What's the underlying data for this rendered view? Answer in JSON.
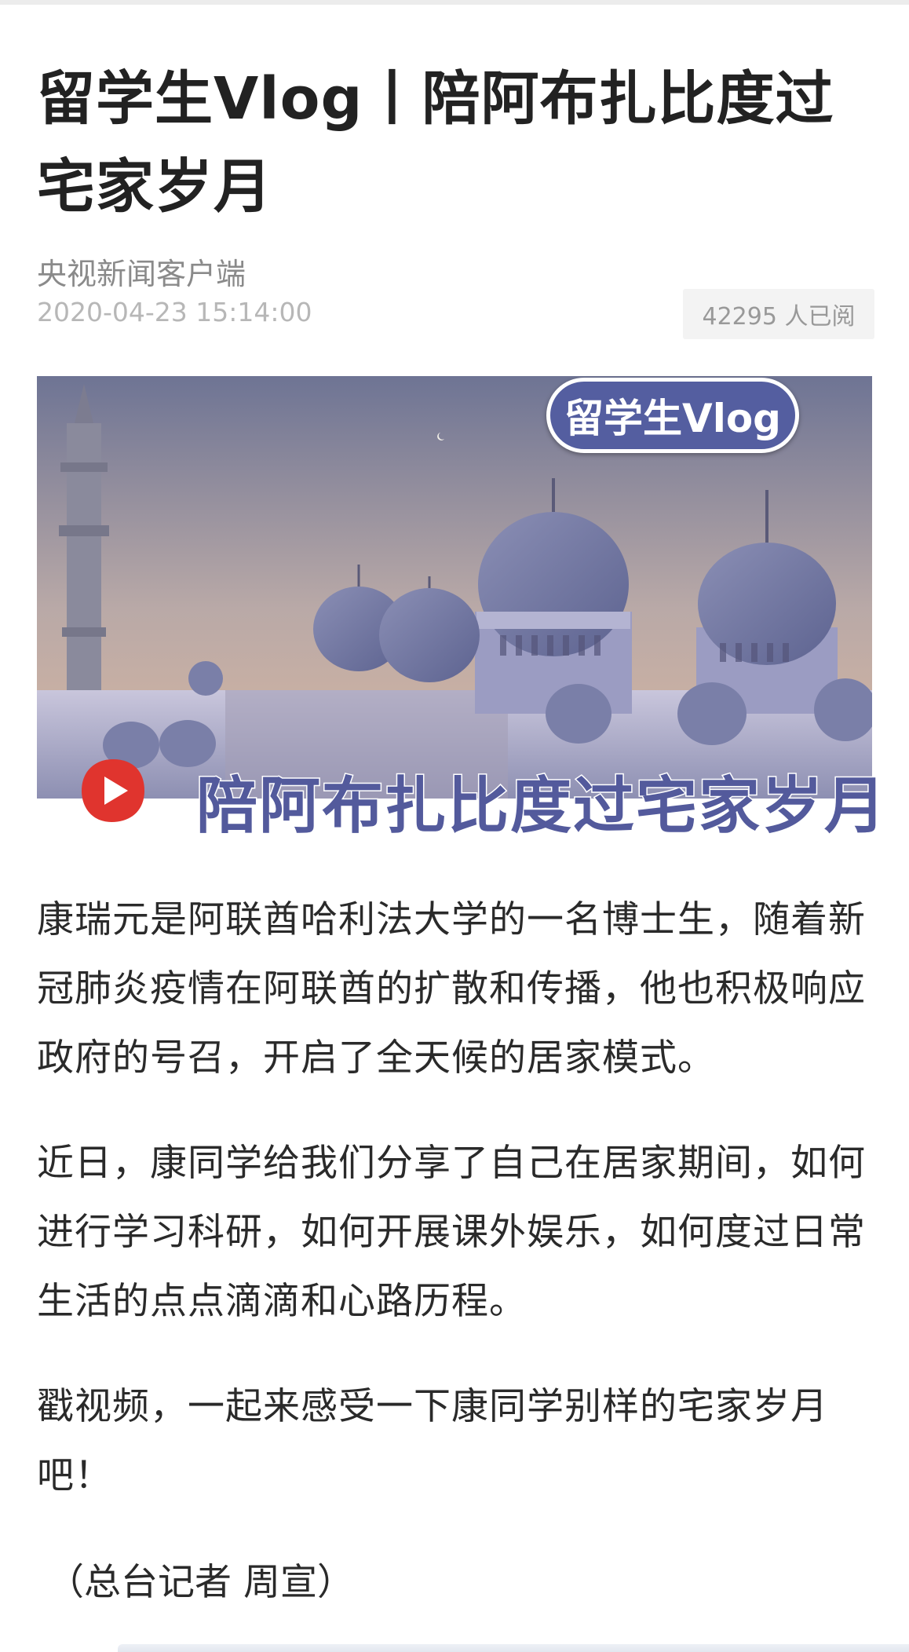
{
  "article": {
    "title": "留学生Vlog丨陪阿布扎比度过宅家岁月",
    "source": "央视新闻客户端",
    "date": "2020-04-23 15:14:00",
    "views": "42295 人已阅"
  },
  "cover": {
    "badge": "留学生Vlog",
    "caption": "陪阿布扎比度过宅家岁月",
    "play_icon": "play-icon"
  },
  "body": {
    "p1": "康瑞元是阿联酋哈利法大学的一名博士生，随着新冠肺炎疫情在阿联酋的扩散和传播，他也积极响应政府的号召，开启了全天候的居家模式。",
    "p2": "近日，康同学给我们分享了自己在居家期间，如何进行学习科研，如何开展课外娱乐，如何度过日常生活的点点滴滴和心路历程。",
    "p3": "戳视频，一起来感受一下康同学别样的宅家岁月吧！",
    "credit": "（总台记者 周宣）"
  },
  "colors": {
    "badge_bg": "#545ea0",
    "caption": "#535a9c",
    "play_icon": "#e0342e"
  }
}
